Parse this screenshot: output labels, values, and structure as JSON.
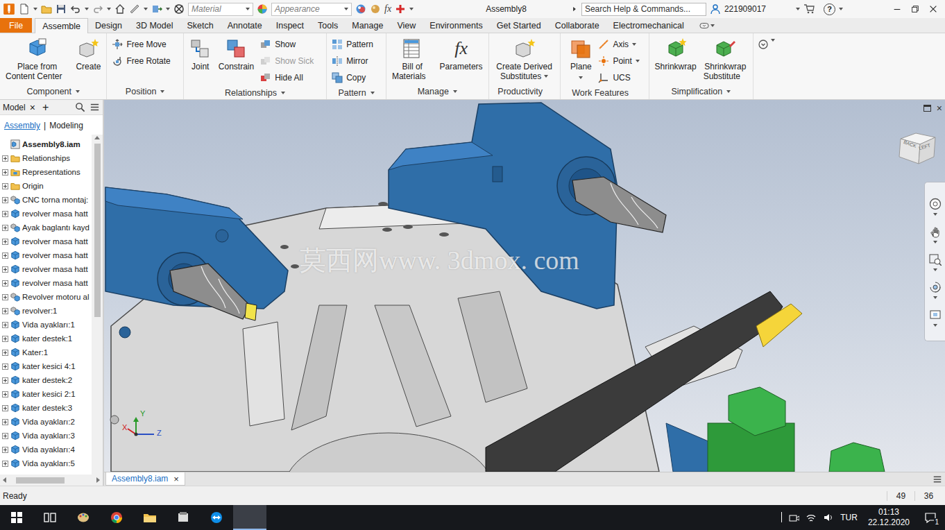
{
  "title_bar": {
    "material": "Material",
    "appearance": "Appearance",
    "fx": "fx",
    "document": "Assembly8",
    "search": {
      "placeholder": "Search Help & Commands..."
    },
    "user": "221909017",
    "help": "?"
  },
  "ribbon": {
    "file_tab": "File",
    "tabs": [
      {
        "label": "Assemble",
        "selected": true
      },
      {
        "label": "Design",
        "selected": false
      },
      {
        "label": "3D Model",
        "selected": false
      },
      {
        "label": "Sketch",
        "selected": false
      },
      {
        "label": "Annotate",
        "selected": false
      },
      {
        "label": "Inspect",
        "selected": false
      },
      {
        "label": "Tools",
        "selected": false
      },
      {
        "label": "Manage",
        "selected": false
      },
      {
        "label": "View",
        "selected": false
      },
      {
        "label": "Environments",
        "selected": false
      },
      {
        "label": "Get Started",
        "selected": false
      },
      {
        "label": "Collaborate",
        "selected": false
      },
      {
        "label": "Electromechanical",
        "selected": false
      }
    ],
    "groups": [
      {
        "label": "Component",
        "menu": true,
        "items": [
          {
            "kind": "large",
            "lines": [
              "Place from",
              "Content Center"
            ],
            "menu": false
          },
          {
            "kind": "large",
            "lines": [
              "Create"
            ],
            "menu": false
          }
        ]
      },
      {
        "label": "Position",
        "menu": true,
        "items": [
          {
            "kind": "stack",
            "buttons": [
              {
                "label": "Free Move",
                "disabled": false,
                "menu": false
              },
              {
                "label": "Free Rotate",
                "disabled": false,
                "menu": false
              }
            ]
          }
        ]
      },
      {
        "label": "Relationships",
        "menu": true,
        "items": [
          {
            "kind": "large",
            "lines": [
              "Joint"
            ],
            "menu": false
          },
          {
            "kind": "large",
            "lines": [
              "Constrain"
            ],
            "menu": false
          },
          {
            "kind": "stack",
            "buttons": [
              {
                "label": "Show",
                "disabled": false,
                "menu": false
              },
              {
                "label": "Show Sick",
                "disabled": true,
                "menu": false
              },
              {
                "label": "Hide All",
                "disabled": false,
                "menu": false
              }
            ]
          }
        ]
      },
      {
        "label": "Pattern",
        "menu": true,
        "items": [
          {
            "kind": "stack",
            "buttons": [
              {
                "label": "Pattern",
                "disabled": false,
                "menu": false
              },
              {
                "label": "Mirror",
                "disabled": false,
                "menu": false
              },
              {
                "label": "Copy",
                "disabled": false,
                "menu": false
              }
            ]
          }
        ]
      },
      {
        "label": "Manage",
        "menu": true,
        "items": [
          {
            "kind": "large",
            "lines": [
              "Bill of",
              "Materials"
            ],
            "menu": false
          },
          {
            "kind": "large",
            "lines": [
              "Parameters"
            ],
            "menu": false,
            "glyph": "fx"
          }
        ]
      },
      {
        "label": "Productivity",
        "menu": false,
        "items": [
          {
            "kind": "large",
            "lines": [
              "Create Derived",
              "Substitutes"
            ],
            "menu": true
          }
        ]
      },
      {
        "label": "Work Features",
        "menu": false,
        "items": [
          {
            "kind": "large",
            "lines": [
              "Plane"
            ],
            "menu": true
          },
          {
            "kind": "stack",
            "buttons": [
              {
                "label": "Axis",
                "disabled": false,
                "menu": true
              },
              {
                "label": "Point",
                "disabled": false,
                "menu": true
              },
              {
                "label": "UCS",
                "disabled": false,
                "menu": false
              }
            ]
          }
        ]
      },
      {
        "label": "Simplification",
        "menu": true,
        "items": [
          {
            "kind": "large",
            "lines": [
              "Shrinkwrap"
            ],
            "menu": false
          },
          {
            "kind": "large",
            "lines": [
              "Shrinkwrap",
              "Substitute"
            ],
            "menu": false
          }
        ]
      }
    ]
  },
  "browser": {
    "title": "Model",
    "close": "×",
    "add": "+",
    "tabs": [
      {
        "label": "Assembly",
        "selected": true
      },
      {
        "label": "Modeling",
        "selected": false
      }
    ],
    "separator": "|",
    "items": [
      {
        "label": "Assembly8.iam",
        "kind": "root",
        "expanded": true
      },
      {
        "label": "Relationships",
        "kind": "folder",
        "expanded": false
      },
      {
        "label": "Representations",
        "kind": "representations",
        "expanded": false
      },
      {
        "label": "Origin",
        "kind": "folder",
        "expanded": false
      },
      {
        "label": "CNC torna montaj:",
        "kind": "assembly",
        "expanded": false
      },
      {
        "label": "revolver masa hatt",
        "kind": "part",
        "expanded": false
      },
      {
        "label": "Ayak baglantı kayd",
        "kind": "assembly",
        "expanded": false
      },
      {
        "label": "revolver masa hatt",
        "kind": "part",
        "expanded": false
      },
      {
        "label": "revolver masa hatt",
        "kind": "part",
        "expanded": false
      },
      {
        "label": "revolver masa hatt",
        "kind": "part",
        "expanded": false
      },
      {
        "label": "revolver masa hatt",
        "kind": "part",
        "expanded": false
      },
      {
        "label": "Revolver motoru al",
        "kind": "assembly",
        "expanded": false
      },
      {
        "label": "revolver:1",
        "kind": "assembly",
        "expanded": false
      },
      {
        "label": "Vida ayakları:1",
        "kind": "part",
        "expanded": false
      },
      {
        "label": "kater destek:1",
        "kind": "part",
        "expanded": false
      },
      {
        "label": "Kater:1",
        "kind": "part",
        "expanded": false
      },
      {
        "label": "kater kesici 4:1",
        "kind": "part",
        "expanded": false
      },
      {
        "label": "kater destek:2",
        "kind": "part",
        "expanded": false
      },
      {
        "label": "kater kesici 2:1",
        "kind": "part",
        "expanded": false
      },
      {
        "label": "kater destek:3",
        "kind": "part",
        "expanded": false
      },
      {
        "label": "Vida ayakları:2",
        "kind": "part",
        "expanded": false
      },
      {
        "label": "Vida ayakları:3",
        "kind": "part",
        "expanded": false
      },
      {
        "label": "Vida ayakları:4",
        "kind": "part",
        "expanded": false
      },
      {
        "label": "Vida ayakları:5",
        "kind": "part",
        "expanded": false
      }
    ]
  },
  "viewport": {
    "watermark": "莫西网www. 3dmox. com",
    "close": "×",
    "viewcube": [
      "BACK",
      "LEFT"
    ],
    "axes": [
      "X",
      "Y",
      "Z"
    ]
  },
  "document_tabs": [
    {
      "label": "Assembly8.iam",
      "close": "×",
      "selected": true
    }
  ],
  "status_bar": {
    "text": "Ready",
    "values": [
      "49",
      "36"
    ]
  },
  "taskbar": {
    "apps": [
      {
        "active": false
      },
      {
        "active": false
      },
      {
        "active": false
      },
      {
        "active": false
      },
      {
        "active": false
      },
      {
        "active": false
      },
      {
        "active": true
      }
    ],
    "language": "TUR",
    "time": "01:13",
    "date": "22.12.2020",
    "notifications": "1"
  }
}
